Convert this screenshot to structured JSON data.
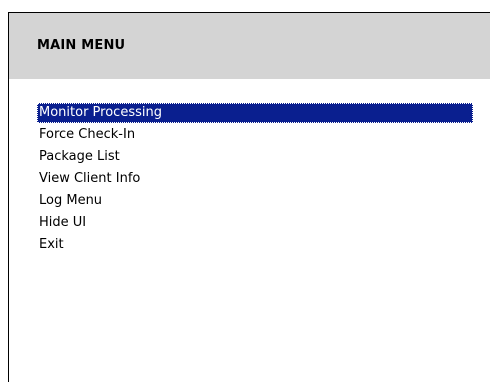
{
  "header": {
    "title": "MAIN MENU"
  },
  "menu": {
    "selected_index": 0,
    "items": [
      {
        "label": "Monitor Processing"
      },
      {
        "label": "Force Check-In"
      },
      {
        "label": "Package List"
      },
      {
        "label": "View Client Info"
      },
      {
        "label": "Log Menu"
      },
      {
        "label": "Hide UI"
      },
      {
        "label": "Exit"
      }
    ]
  },
  "colors": {
    "header_bg": "#d4d4d4",
    "selection_bg": "#0a1f8f",
    "selection_text": "#ffffff"
  }
}
